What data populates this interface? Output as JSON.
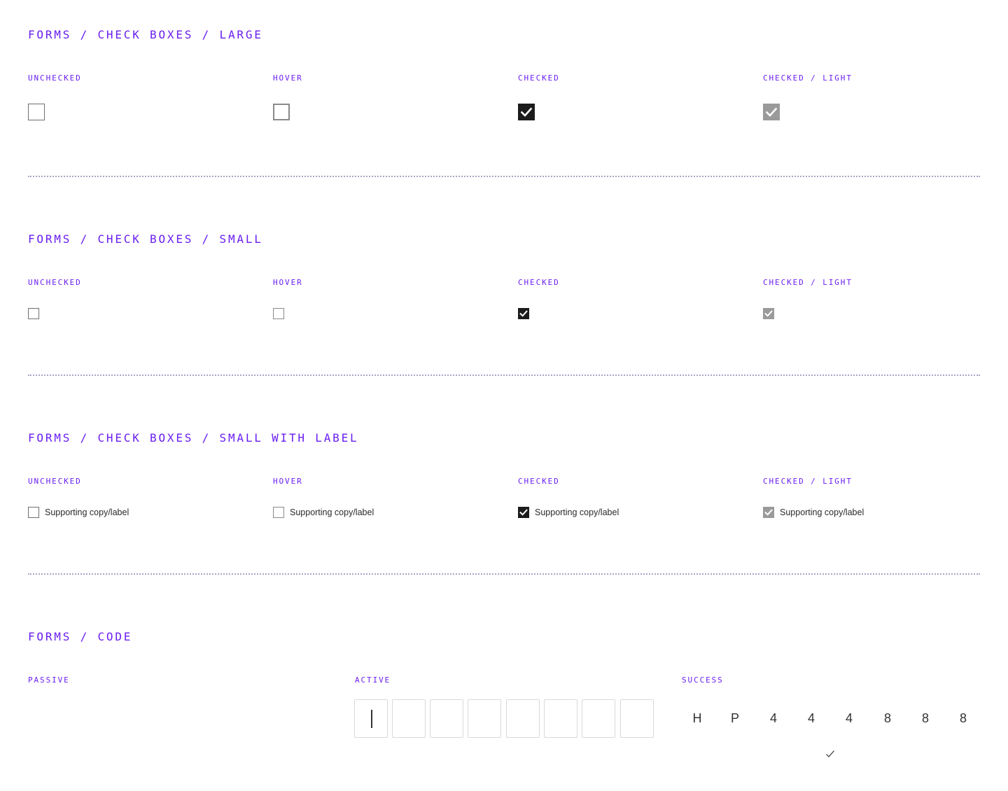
{
  "sections": {
    "large": {
      "title": "FORMS / CHECK BOXES / LARGE",
      "states": [
        "UNCHECKED",
        "HOVER",
        "CHECKED",
        "CHECKED / LIGHT"
      ]
    },
    "small": {
      "title": "FORMS / CHECK BOXES / SMALL",
      "states": [
        "UNCHECKED",
        "HOVER",
        "CHECKED",
        "CHECKED / LIGHT"
      ]
    },
    "small_label": {
      "title": "FORMS / CHECK BOXES / SMALL WITH LABEL",
      "states": [
        "UNCHECKED",
        "HOVER",
        "CHECKED",
        "CHECKED / LIGHT"
      ],
      "label": "Supporting copy/label"
    },
    "code": {
      "title": "FORMS / CODE",
      "states": [
        "PASSIVE",
        "ACTIVE",
        "SUCCESS"
      ],
      "success_chars": [
        "H",
        "P",
        "4",
        "4",
        "4",
        "8",
        "8",
        "8"
      ],
      "success_icon": "checkmark-icon"
    }
  },
  "colors": {
    "accent": "#6a1ef0",
    "checked": "#1c1c1c",
    "checked_light": "#9a9a9a",
    "divider": "#a9a3c4"
  }
}
